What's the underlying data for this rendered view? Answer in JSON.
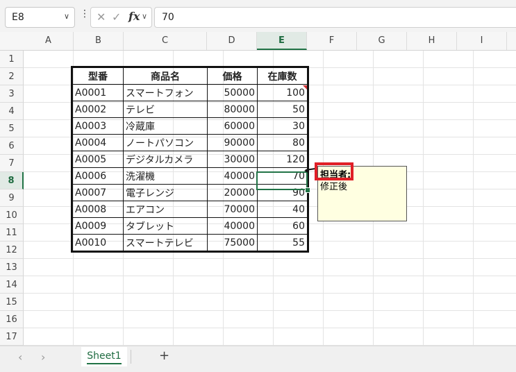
{
  "formula_bar": {
    "name_box": "E8",
    "fx_label": "fx",
    "formula_value": "70"
  },
  "columns": [
    "A",
    "B",
    "C",
    "D",
    "E",
    "F",
    "G",
    "H",
    "I"
  ],
  "selected_column": "E",
  "rows": [
    "1",
    "2",
    "3",
    "4",
    "5",
    "6",
    "7",
    "8",
    "9",
    "10",
    "11",
    "12",
    "13",
    "14",
    "15",
    "16",
    "17"
  ],
  "selected_row": "8",
  "table": {
    "headers": [
      "型番",
      "商品名",
      "価格",
      "在庫数"
    ],
    "rows": [
      [
        "A0001",
        "スマートフォン",
        "50000",
        "100"
      ],
      [
        "A0002",
        "テレビ",
        "80000",
        "50"
      ],
      [
        "A0003",
        "冷蔵庫",
        "60000",
        "30"
      ],
      [
        "A0004",
        "ノートパソコン",
        "90000",
        "80"
      ],
      [
        "A0005",
        "デジタルカメラ",
        "30000",
        "120"
      ],
      [
        "A0006",
        "洗濯機",
        "40000",
        "70"
      ],
      [
        "A0007",
        "電子レンジ",
        "20000",
        "90"
      ],
      [
        "A0008",
        "エアコン",
        "70000",
        "40"
      ],
      [
        "A0009",
        "タブレット",
        "40000",
        "60"
      ],
      [
        "A0010",
        "スマートテレビ",
        "75000",
        "55"
      ]
    ]
  },
  "note": {
    "author": "担当者:",
    "body": "修正後"
  },
  "sheets": {
    "active": "Sheet1",
    "add_label": "+"
  },
  "colors": {
    "accent": "#217346",
    "highlight_box": "#e01f26",
    "note_bg": "#ffffe1"
  }
}
